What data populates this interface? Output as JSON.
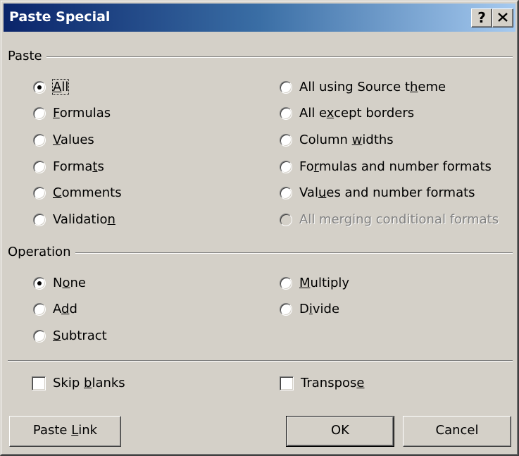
{
  "dialog": {
    "title": "Paste Special",
    "help_button": "?"
  },
  "paste": {
    "group_label": "Paste",
    "options": [
      {
        "pre": "",
        "key": "A",
        "post": "ll",
        "checked": true,
        "disabled": false
      },
      {
        "pre": "",
        "key": "F",
        "post": "ormulas",
        "checked": false,
        "disabled": false
      },
      {
        "pre": "",
        "key": "V",
        "post": "alues",
        "checked": false,
        "disabled": false
      },
      {
        "pre": "Forma",
        "key": "t",
        "post": "s",
        "checked": false,
        "disabled": false
      },
      {
        "pre": "",
        "key": "C",
        "post": "omments",
        "checked": false,
        "disabled": false
      },
      {
        "pre": "Validatio",
        "key": "n",
        "post": "",
        "checked": false,
        "disabled": false
      },
      {
        "pre": "All using Source t",
        "key": "h",
        "post": "eme",
        "checked": false,
        "disabled": false
      },
      {
        "pre": "All e",
        "key": "x",
        "post": "cept borders",
        "checked": false,
        "disabled": false
      },
      {
        "pre": "Column ",
        "key": "w",
        "post": "idths",
        "checked": false,
        "disabled": false
      },
      {
        "pre": "Fo",
        "key": "r",
        "post": "mulas and number formats",
        "checked": false,
        "disabled": false
      },
      {
        "pre": "Val",
        "key": "u",
        "post": "es and number formats",
        "checked": false,
        "disabled": false
      },
      {
        "pre": "All merging conditional formats",
        "key": "",
        "post": "",
        "checked": false,
        "disabled": true
      }
    ]
  },
  "operation": {
    "group_label": "Operation",
    "options": [
      {
        "pre": "N",
        "key": "o",
        "post": "ne",
        "checked": true,
        "disabled": false
      },
      {
        "pre": "A",
        "key": "d",
        "post": "d",
        "checked": false,
        "disabled": false
      },
      {
        "pre": "",
        "key": "S",
        "post": "ubtract",
        "checked": false,
        "disabled": false
      },
      {
        "pre": "",
        "key": "M",
        "post": "ultiply",
        "checked": false,
        "disabled": false
      },
      {
        "pre": "D",
        "key": "i",
        "post": "vide",
        "checked": false,
        "disabled": false
      }
    ]
  },
  "checkboxes": {
    "skip_blanks": {
      "pre": "Skip ",
      "key": "b",
      "post": "lanks",
      "checked": false
    },
    "transpose": {
      "pre": "Transpos",
      "key": "e",
      "post": "",
      "checked": false
    }
  },
  "buttons": {
    "paste_link": {
      "pre": "Paste ",
      "key": "L",
      "post": "ink"
    },
    "ok": "OK",
    "cancel": "Cancel"
  }
}
